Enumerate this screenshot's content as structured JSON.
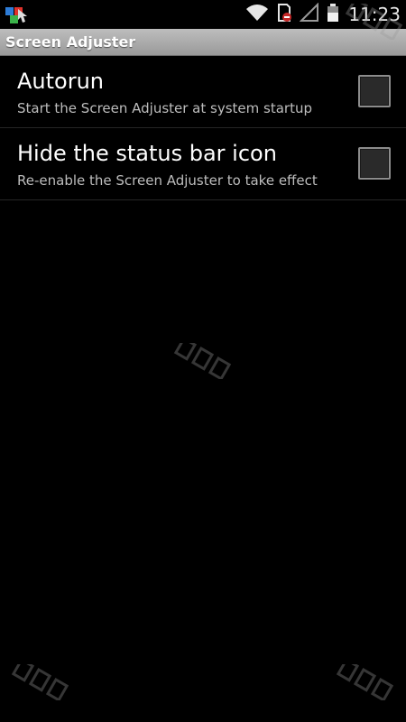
{
  "status_bar": {
    "time": "11:23",
    "icons": [
      "app-notification-icon",
      "wifi-icon",
      "sd-card-blocked-icon",
      "signal-icon",
      "battery-icon"
    ]
  },
  "app": {
    "title": "Screen Adjuster"
  },
  "preferences": [
    {
      "title": "Autorun",
      "summary": "Start the Screen Adjuster at system startup",
      "checked": false
    },
    {
      "title": "Hide the status bar icon",
      "summary": "Re-enable the Screen Adjuster to take effect",
      "checked": false
    }
  ],
  "colors": {
    "background": "#000000",
    "title_bar": "#aaaaaa",
    "summary_text": "#bdbdbd",
    "checkbox_border": "#8c8c8c"
  }
}
